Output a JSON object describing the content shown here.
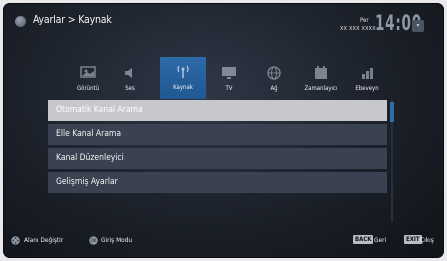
{
  "header": {
    "breadcrumb": "Ayarlar > Kaynak",
    "day": "Per",
    "date": "XX XXX XXXX",
    "clock": "14:00"
  },
  "categories": [
    {
      "label": "Görüntü",
      "icon": "picture-icon",
      "active": false
    },
    {
      "label": "Ses",
      "icon": "speaker-icon",
      "active": false
    },
    {
      "label": "Kaynak",
      "icon": "antenna-icon",
      "active": true
    },
    {
      "label": "TV",
      "icon": "tv-icon",
      "active": false
    },
    {
      "label": "Ağ",
      "icon": "globe-icon",
      "active": false
    },
    {
      "label": "Zamanlayıcı",
      "icon": "timer-icon",
      "active": false
    },
    {
      "label": "Ebeveyn",
      "icon": "parental-icon",
      "active": false
    }
  ],
  "menu": {
    "items": [
      {
        "label": "Otomatik Kanal Arama",
        "selected": true
      },
      {
        "label": "Elle Kanal Arama",
        "selected": false
      },
      {
        "label": "Kanal Düzenleyici",
        "selected": false
      },
      {
        "label": "Gelişmiş Ayarlar",
        "selected": false
      }
    ]
  },
  "footer": {
    "nav_label": "Alanı Değiştir",
    "ok_label": "Giriş Modu",
    "back_key": "BACK",
    "back_label": "Geri",
    "exit_key": "EXIT",
    "exit_label": "Çıkış"
  },
  "colors": {
    "active_tab": "#2d6aa8",
    "selected_item": "#c7c8cb",
    "menu_item": "#3a4150",
    "scrollbar": "#2e6cab"
  }
}
